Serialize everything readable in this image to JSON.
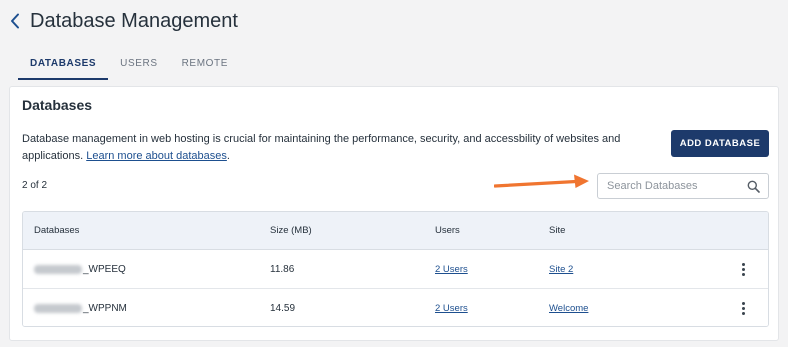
{
  "page": {
    "title": "Database Management"
  },
  "tabs": [
    {
      "label": "DATABASES",
      "active": true
    },
    {
      "label": "USERS",
      "active": false
    },
    {
      "label": "REMOTE",
      "active": false
    }
  ],
  "card": {
    "title": "Databases",
    "description": "Database management in web hosting is crucial for maintaining the performance, security, and accessbility of websites and applications.",
    "learn_more": "Learn more about databases",
    "add_button": "ADD DATABASE",
    "count": "2 of 2"
  },
  "search": {
    "placeholder": "Search Databases",
    "value": ""
  },
  "table": {
    "headers": {
      "name": "Databases",
      "size": "Size (MB)",
      "users": "Users",
      "site": "Site"
    },
    "rows": [
      {
        "name_suffix": "_WPEEQ",
        "size": "11.86",
        "users": "2 Users",
        "site": "Site 2"
      },
      {
        "name_suffix": "_WPPNM",
        "size": "14.59",
        "users": "2 Users",
        "site": "Welcome"
      }
    ]
  },
  "colors": {
    "primary": "#1d3a6b",
    "link": "#1d4f8f",
    "annotation_arrow": "#f07530",
    "header_bg": "#eef2f8"
  }
}
